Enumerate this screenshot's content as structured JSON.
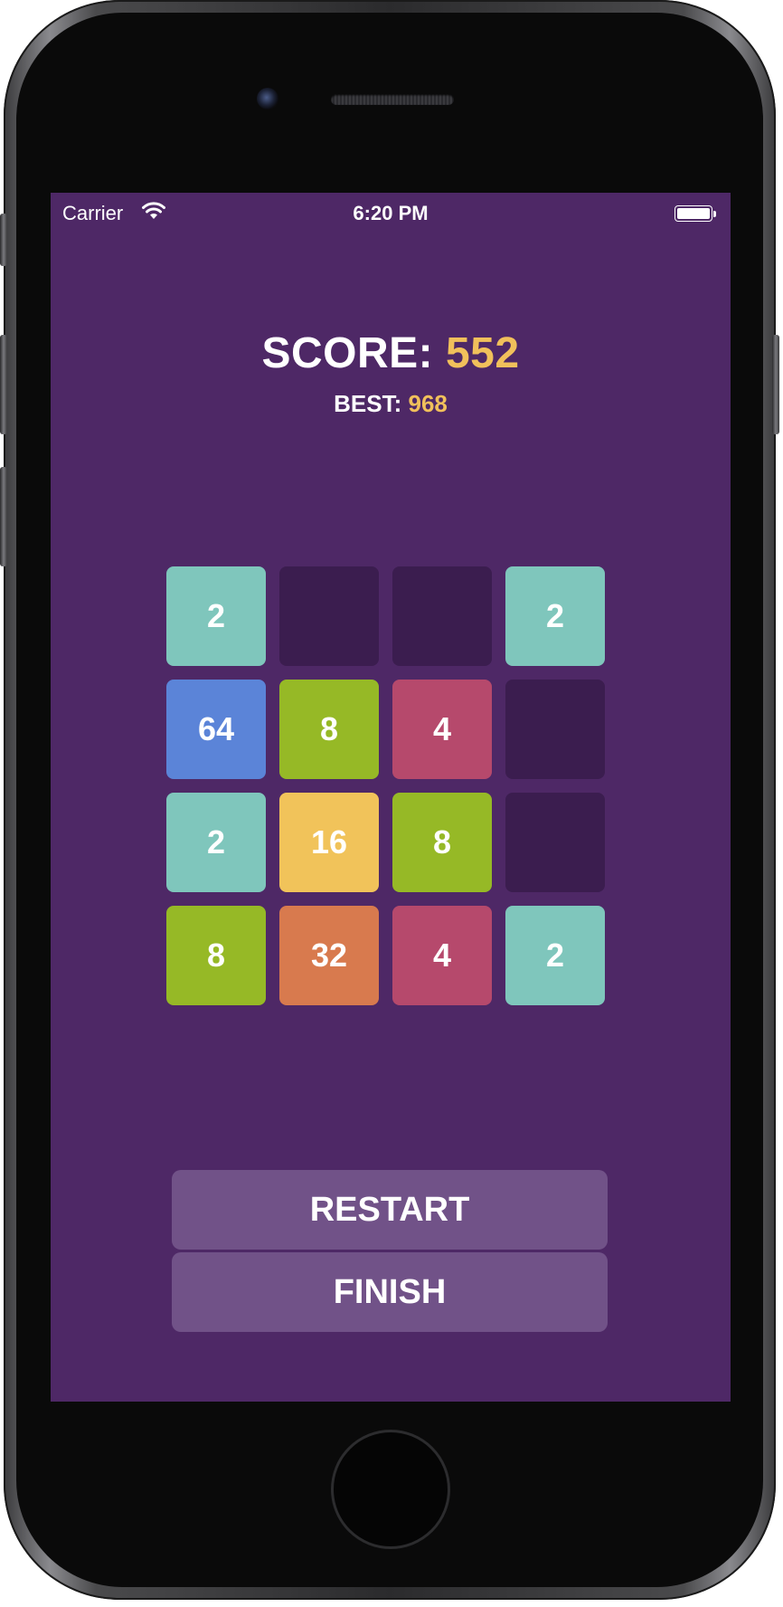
{
  "status_bar": {
    "carrier": "Carrier",
    "time": "6:20 PM",
    "battery_level": 1.0,
    "wifi_icon": "wifi-icon",
    "battery_icon": "battery-icon"
  },
  "score": {
    "label": "SCORE:",
    "value": "552",
    "best_label": "BEST:",
    "best_value": "968"
  },
  "board": {
    "rows": [
      [
        "2",
        "",
        "",
        "2"
      ],
      [
        "64",
        "8",
        "4",
        ""
      ],
      [
        "2",
        "16",
        "8",
        ""
      ],
      [
        "8",
        "32",
        "4",
        "2"
      ]
    ]
  },
  "tile_colors": {
    "empty": "#3b1d4f",
    "2": "#7fc6bc",
    "4": "#b6496c",
    "8": "#96b926",
    "16": "#f1c35a",
    "32": "#d87a4e",
    "64": "#5b84d8"
  },
  "buttons": {
    "restart_label": "RESTART",
    "finish_label": "FINISH"
  },
  "colors": {
    "background": "#4e2866",
    "accent": "#f1c05b",
    "button": "#715288"
  }
}
